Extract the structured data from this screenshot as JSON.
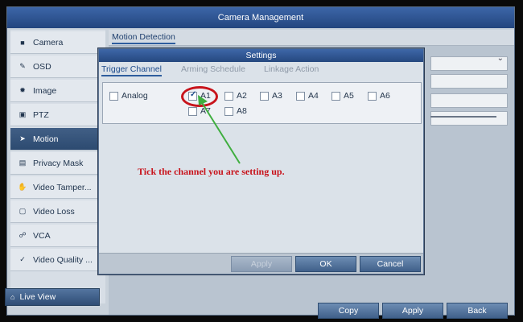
{
  "window": {
    "title": "Camera Management"
  },
  "sidebar": {
    "items": [
      {
        "label": "Camera",
        "icon": "camera-icon",
        "active": false
      },
      {
        "label": "OSD",
        "icon": "osd-icon",
        "active": false
      },
      {
        "label": "Image",
        "icon": "image-icon",
        "active": false
      },
      {
        "label": "PTZ",
        "icon": "ptz-icon",
        "active": false
      },
      {
        "label": "Motion",
        "icon": "motion-icon",
        "active": true
      },
      {
        "label": "Privacy Mask",
        "icon": "privacy-mask-icon",
        "active": false
      },
      {
        "label": "Video Tamper...",
        "icon": "video-tamper-icon",
        "active": false
      },
      {
        "label": "Video Loss",
        "icon": "video-loss-icon",
        "active": false
      },
      {
        "label": "VCA",
        "icon": "vca-icon",
        "active": false
      },
      {
        "label": "Video Quality ...",
        "icon": "video-quality-icon",
        "active": false
      }
    ],
    "live_view": "Live View"
  },
  "content": {
    "tab": "Motion Detection",
    "buttons": {
      "copy": "Copy",
      "apply": "Apply",
      "back": "Back"
    }
  },
  "dialog": {
    "title": "Settings",
    "tabs": [
      {
        "label": "Trigger Channel",
        "active": true
      },
      {
        "label": "Arming Schedule",
        "active": false
      },
      {
        "label": "Linkage Action",
        "active": false
      }
    ],
    "channels": [
      {
        "label": "Analog",
        "checked": false
      },
      {
        "label": "A1",
        "checked": true
      },
      {
        "label": "A2",
        "checked": false
      },
      {
        "label": "A3",
        "checked": false
      },
      {
        "label": "A4",
        "checked": false
      },
      {
        "label": "A5",
        "checked": false
      },
      {
        "label": "A6",
        "checked": false
      },
      {
        "label": "A7",
        "checked": false
      },
      {
        "label": "A8",
        "checked": false
      }
    ],
    "buttons": {
      "apply": "Apply",
      "ok": "OK",
      "cancel": "Cancel"
    }
  },
  "annotation": {
    "text": "Tick the channel you are setting up."
  },
  "colors": {
    "accent_blue": "#2f5e9e",
    "annotation_red": "#c8141c",
    "annotation_arrow": "#3fae3f"
  }
}
